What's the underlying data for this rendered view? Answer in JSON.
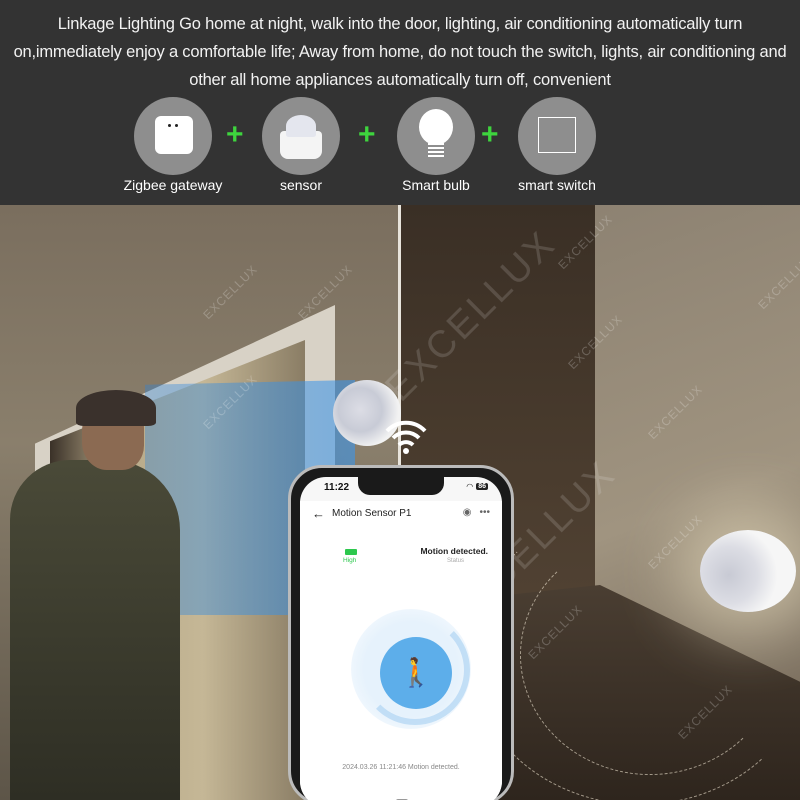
{
  "header": {
    "description": "Linkage Lighting Go home at night, walk into the door, lighting, air conditioning automatically turn on,immediately enjoy a comfortable life; Away from home, do not touch the switch, lights, air conditioning and other all home appliances  automatically turn off, convenient"
  },
  "devices": [
    {
      "label": "Zigbee gateway",
      "icon": "gateway-icon"
    },
    {
      "label": "sensor",
      "icon": "motion-sensor-icon"
    },
    {
      "label": "Smart bulb",
      "icon": "bulb-icon"
    },
    {
      "label": "smart switch",
      "icon": "switch-icon"
    }
  ],
  "plus_symbol": "+",
  "colors": {
    "accent_plus": "#3ed43e",
    "app_blue": "#5daeea",
    "battery_green": "#2cc84d"
  },
  "phone": {
    "time": "11:22",
    "battery": "86",
    "back_symbol": "←",
    "title": "Motion Sensor P1",
    "more_symbol": "•••",
    "cam_symbol": "◉",
    "battery_label": "High",
    "status_value": "Motion detected.",
    "status_label": "Status",
    "motion_symbol": "🚶",
    "log_entry": "2024.03.26  11:21:46  Motion detected."
  },
  "watermark": "EXCELLUX"
}
